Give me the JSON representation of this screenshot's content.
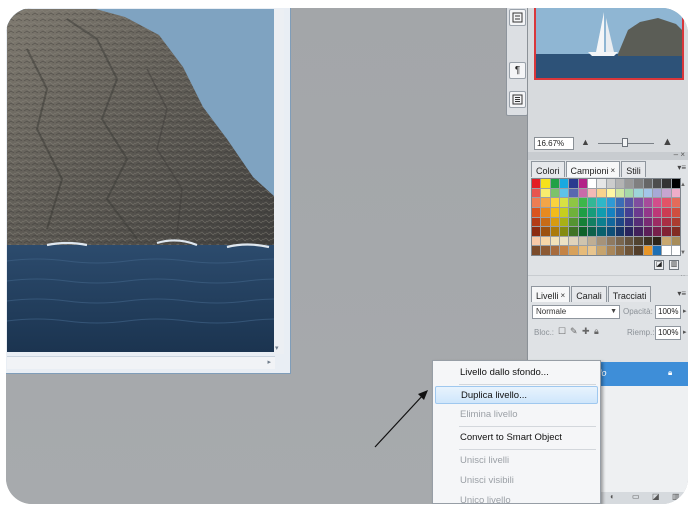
{
  "navigator": {
    "zoom_value": "16.67%"
  },
  "toolbar": {
    "items": [
      {
        "icon": "character-icon"
      },
      {
        "icon": "paragraph-icon",
        "glyph": "¶"
      },
      {
        "icon": "info-icon"
      }
    ]
  },
  "swatches_panel": {
    "tabs": [
      {
        "label": "Colori",
        "active": false,
        "closable": false
      },
      {
        "label": "Campioni",
        "active": true,
        "closable": true
      },
      {
        "label": "Stili",
        "active": false,
        "closable": false
      }
    ],
    "swatch_colors": [
      [
        "#e31e24",
        "#f5e11c",
        "#22a145",
        "#1aa9e0",
        "#2a3a8f",
        "#b32288",
        "#ffffff",
        "#e6e6e6",
        "#cccccc",
        "#b3b3b3",
        "#999999",
        "#808080",
        "#666666",
        "#4d4d4d",
        "#333333",
        "#000000"
      ],
      [
        "#e8554f",
        "#f9ec6e",
        "#7cc36b",
        "#5fc3e8",
        "#5968b0",
        "#c96aa9",
        "#f4b9b6",
        "#f8d38d",
        "#fff7a4",
        "#cfe7a3",
        "#a6d8a8",
        "#9ed5d9",
        "#a3c6e9",
        "#a7a9d6",
        "#c7a5d0",
        "#efadc9"
      ],
      [
        "#ee7d53",
        "#f3a548",
        "#fbd33e",
        "#d8e143",
        "#8ec645",
        "#3cb74a",
        "#33b796",
        "#2fb7c8",
        "#2f9ad5",
        "#3b6db6",
        "#5754a4",
        "#7f4e9f",
        "#a74c9a",
        "#d24d8b",
        "#e25367",
        "#e46b5a"
      ],
      [
        "#d9541f",
        "#e78a1f",
        "#f3bb1a",
        "#c6cf1f",
        "#6fb13b",
        "#1e9e45",
        "#179c7b",
        "#119caf",
        "#1681c0",
        "#2858a3",
        "#443f93",
        "#6b3a8f",
        "#93378a",
        "#bd3778",
        "#cc3b53",
        "#cf4f3f"
      ],
      [
        "#b33b16",
        "#c86b15",
        "#d89b10",
        "#a8b117",
        "#549432",
        "#158037",
        "#127f62",
        "#0c7f8f",
        "#12679d",
        "#1f4686",
        "#36317a",
        "#562d77",
        "#792b73",
        "#9c2b63",
        "#a92e43",
        "#ab3c30"
      ],
      [
        "#8c2a10",
        "#9c510f",
        "#ab7a0b",
        "#848b11",
        "#3f7326",
        "#0e622a",
        "#0d614a",
        "#08616d",
        "#0d4f78",
        "#173567",
        "#28245d",
        "#41215b",
        "#5c1f58",
        "#771f4b",
        "#812233",
        "#822c23"
      ],
      [
        "#f8c9a8",
        "#f7d6a7",
        "#f2e1b8",
        "#ece2c4",
        "#dfd3bb",
        "#cfc4ae",
        "#bfae94",
        "#a6937a",
        "#8f7a61",
        "#79664f",
        "#64533f",
        "#514330",
        "#3f3423",
        "#2e2518",
        "#c9a86f",
        "#a88d5a"
      ],
      [
        "#7b4b2a",
        "#8d5a33",
        "#a76b3c",
        "#c48345",
        "#d7a15b",
        "#e6bb7a",
        "#e8c58e",
        "#c6a46e",
        "#a8865a",
        "#8a6b47",
        "#6e5438",
        "#543f2a",
        "#e89628",
        "#1e6fb3",
        "#ffffff",
        "#ffffff"
      ]
    ]
  },
  "layers_panel": {
    "tabs": [
      {
        "label": "Livelli",
        "active": true,
        "closable": true
      },
      {
        "label": "Canali",
        "active": false,
        "closable": false
      },
      {
        "label": "Tracciati",
        "active": false,
        "closable": false
      }
    ],
    "blend_mode": "Normale",
    "opacity_label": "Opacità:",
    "opacity_value": "100%",
    "lock_label": "Bloc.:",
    "fill_label": "Riemp.:",
    "fill_value": "100%",
    "layer_name": "Sfondo"
  },
  "context_menu": {
    "items": [
      {
        "label": "Livello dallo sfondo...",
        "enabled": true,
        "highlighted": false,
        "separator_after": true
      },
      {
        "label": "Duplica livello...",
        "enabled": true,
        "highlighted": true,
        "separator_after": false
      },
      {
        "label": "Elimina livello",
        "enabled": false,
        "highlighted": false,
        "separator_after": true
      },
      {
        "label": "Convert to Smart Object",
        "enabled": true,
        "highlighted": false,
        "separator_after": true
      },
      {
        "label": "Unisci livelli",
        "enabled": false,
        "highlighted": false,
        "separator_after": false
      },
      {
        "label": "Unisci visibili",
        "enabled": false,
        "highlighted": false,
        "separator_after": false
      },
      {
        "label": "Unico livello",
        "enabled": false,
        "highlighted": false,
        "separator_after": false
      }
    ]
  },
  "colors": {
    "workspace": "#a4a7aa",
    "selection": "#3e8ed8",
    "nav_frame": "#d9373b"
  }
}
